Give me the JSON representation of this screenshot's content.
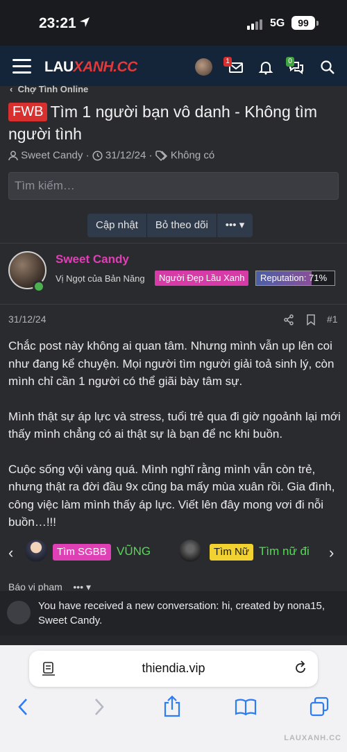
{
  "status": {
    "time": "23:21",
    "network": "5G",
    "battery": "99"
  },
  "header": {
    "logo_a": "LAU",
    "logo_b": "XANH.CC",
    "messages_badge": "1",
    "chat_badge": "0"
  },
  "breadcrumb": "Chợ Tình Online",
  "thread": {
    "prefix": "FWB",
    "title": "Tìm 1 người bạn vô danh - Không tìm người tình",
    "author": "Sweet Candy",
    "date": "31/12/24",
    "tags": "Không có"
  },
  "search": {
    "placeholder": "Tìm kiếm…"
  },
  "actions": {
    "update": "Cập nhật",
    "unfollow": "Bỏ theo dõi",
    "more": "•••"
  },
  "user": {
    "name": "Sweet Candy",
    "title": "Vị Ngọt của Bản Năng",
    "badge": "Người Đẹp Lầu Xanh",
    "reputation_label": "Reputation: 71%",
    "reputation": 0.71
  },
  "post": {
    "date": "31/12/24",
    "number": "#1",
    "paragraphs": [
      "Chắc post này không ai quan tâm. Nhưng mình vẫn up lên coi như đang kể chuyện. Mọi người tìm người giải toả sinh lý, còn mình chỉ cần 1 người có thể giãi bày tâm sự.",
      "Mình thật sự áp lực và stress, tuổi trẻ qua đi giờ ngoảnh lại mới thấy mình chẳng có ai thật sự là bạn để nc khi buồn.",
      "Cuộc sống vội vàng quá. Mình nghĩ rằng mình vẫn còn trẻ, nhưng thật ra đời đầu 9x cũng ba mấy mùa xuân rồi. Gia đình, công việc làm mình thấy áp lực. Viết lên đây mong vơi đi nỗi buồn…!!!"
    ]
  },
  "signature": {
    "tag1": "Tìm SGBB",
    "text1": "VŨNG",
    "tag2": "Tìm Nữ",
    "text2": "Tìm nữ đi"
  },
  "report": "Báo vi phạm",
  "toast": "You have received a new conversation: hi, created by nona15, Sweet Candy.",
  "browser": {
    "url": "thiendia.vip"
  },
  "watermark": "LAUXANH.CC",
  "colors": {
    "header": "#14253a",
    "accent_pink": "#e040b5",
    "prefix_red": "#d8302e",
    "green": "#57d957"
  }
}
